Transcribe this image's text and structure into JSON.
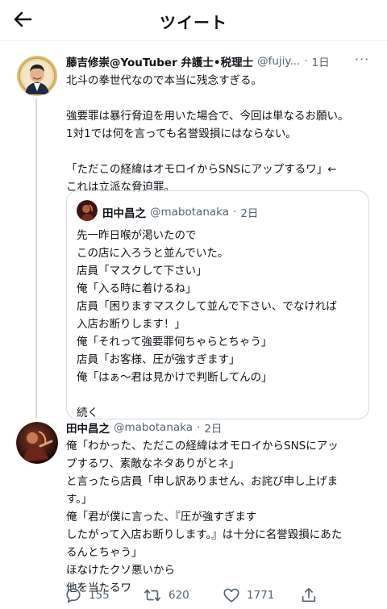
{
  "header": {
    "title": "ツイート"
  },
  "tweet1": {
    "name": "藤吉修崇@YouTuber 弁護士•税理士",
    "handle": "@fujiy...",
    "separator": "·",
    "time": "1日",
    "more": "···",
    "text": "北斗の拳世代なので本当に残念すぎる。\n\n強要罪は暴行脅迫を用いた場合で、今回は単なるお願い。\n1対1では何を言っても名誉毀損にはならない。\n\n「ただこの経緯はオモロイからSNSにアップするワ」←\nこれは立派な脅迫罪。"
  },
  "quote": {
    "name": "田中昌之",
    "handle": "@mabotanaka",
    "separator": "·",
    "time": "2日",
    "text": "先一昨日喉が渇いたので\nこの店に入ろうと並んでいた。\n店員「マスクして下さい」\n俺「入る時に着けるね」\n店員「困りますマスクして並んで下さい、でなければ\n入店お断りします！」\n俺「それって強要罪何ちゃらとちゃう」\n店員「お客様、圧が強すぎます」\n俺「はぁ〜君は見かけで判断してんの」\n\n続く"
  },
  "tweet2": {
    "name": "田中昌之",
    "handle": "@mabotanaka",
    "separator": "·",
    "time": "2日",
    "text": "俺「わかった、ただこの経緯はオモロイからSNSにアッ\nプするワ、素敵なネタありがとネ」\nと言ったら店員「申し訳ありません、お詫び申し上げま\nす。」\n俺「君が僕に言った、『圧が強すぎます\nしたがって入店お断りします。』は十分に名誉毀損にあた\nるんとちゃう」\nほなけたクソ悪いから\n他を当たるワ",
    "replies": "155",
    "retweets": "620",
    "likes": "1771"
  },
  "colors": {
    "text": "#0f1419",
    "secondary": "#536471",
    "border": "#cfd9de"
  }
}
